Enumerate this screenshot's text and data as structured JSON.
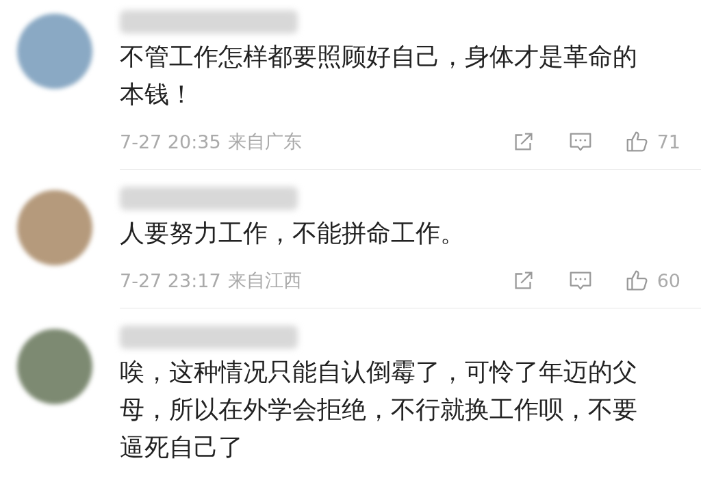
{
  "comments": [
    {
      "text": "不管工作怎样都要照顾好自己，身体才是革命的本钱！",
      "time": "7-27 20:35",
      "location": "来自广东",
      "likes": "71"
    },
    {
      "text": "人要努力工作，不能拼命工作。",
      "time": "7-27 23:17",
      "location": "来自江西",
      "likes": "60"
    },
    {
      "text": "唉，这种情况只能自认倒霉了，可怜了年迈的父母，所以在外学会拒绝，不行就换工作呗，不要逼死自己了"
    }
  ]
}
